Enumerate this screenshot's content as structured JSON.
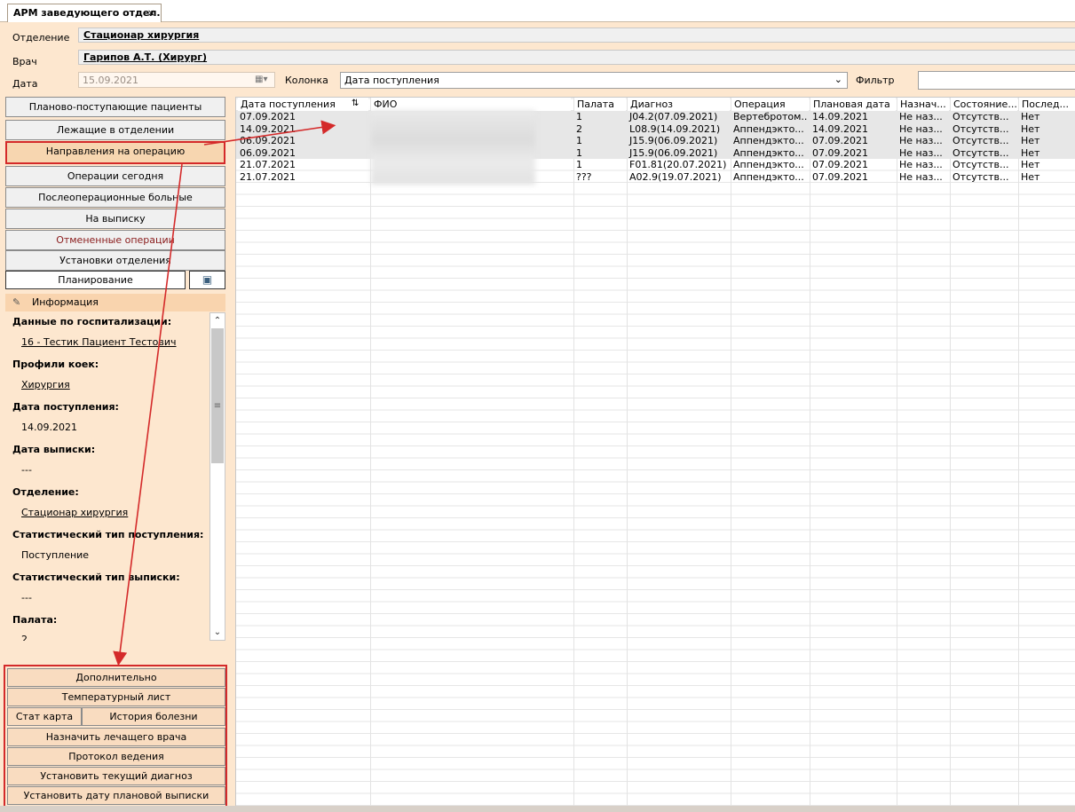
{
  "tab": {
    "title": "АРМ заведующего отдел...",
    "close": "×"
  },
  "header": {
    "department_label": "Отделение",
    "department_value": "Стационар  хирургия",
    "doctor_label": "Врач",
    "doctor_value": "Гарипов А.Т. (Хирург)",
    "date_label": "Дата",
    "date_value": "15.09.2021",
    "column_label": "Колонка",
    "column_value": "Дата поступления",
    "filter_label": "Фильтр",
    "filter_value": ""
  },
  "nav": [
    {
      "label": "Планово-поступающие пациенты"
    },
    {
      "label": "Лежащие в отделении"
    },
    {
      "label": "Направления на операцию"
    },
    {
      "label": "Операции сегодня"
    },
    {
      "label": "Послеоперационные больные"
    },
    {
      "label": "На выписку"
    },
    {
      "label": "Отмененные операции"
    },
    {
      "label": "Установки отделения"
    }
  ],
  "planning_label": "Планирование",
  "info": {
    "title": "Информация",
    "hosp_title": "Данные по госпитализации:",
    "hosp_value": "16 - Тестик Пациент Тестович",
    "beds_title": "Профили коек:",
    "beds_value": "Хирургия",
    "admit_title": "Дата поступления:",
    "admit_value": "14.09.2021",
    "discharge_title": "Дата выписки:",
    "discharge_value": "---",
    "dept_title": "Отделение:",
    "dept_value": "Стационар  хирургия",
    "stat_in_title": "Статистический тип поступления:",
    "stat_in_value": "Поступление",
    "stat_out_title": "Статистический тип выписки:",
    "stat_out_value": "---",
    "ward_title": "Палата:",
    "ward_value": "2"
  },
  "actions": {
    "extra": "Дополнительно",
    "temp_sheet": "Температурный лист",
    "stat_card": "Стат карта",
    "history": "История болезни",
    "assign_doctor": "Назначить лечащего врача",
    "protocol": "Протокол ведения",
    "set_diagnosis": "Установить текущий диагноз",
    "set_discharge": "Установить дату плановой выписки"
  },
  "grid": {
    "headers": [
      "Дата поступления",
      "ФИО",
      "Палата",
      "Диагноз",
      "Операция",
      "Плановая дата",
      "Назнач...",
      "Состояние...",
      "Послед..."
    ],
    "rows": [
      [
        "07.09.2021",
        "",
        "1",
        "J04.2(07.09.2021)",
        "Вертебротом...",
        "14.09.2021",
        "Не наз...",
        "Отсутств...",
        "Нет"
      ],
      [
        "14.09.2021",
        "",
        "2",
        "L08.9(14.09.2021)",
        "Аппендэкто...",
        "14.09.2021",
        "Не наз...",
        "Отсутств...",
        "Нет"
      ],
      [
        "06.09.2021",
        "",
        "1",
        "J15.9(06.09.2021)",
        "Аппендэкто...",
        "07.09.2021",
        "Не наз...",
        "Отсутств...",
        "Нет"
      ],
      [
        "06.09.2021",
        "",
        "1",
        "J15.9(06.09.2021)",
        "Аппендэкто...",
        "07.09.2021",
        "Не наз...",
        "Отсутств...",
        "Нет"
      ],
      [
        "21.07.2021",
        "",
        "1",
        "F01.81(20.07.2021)",
        "Аппендэкто...",
        "07.09.2021",
        "Не наз...",
        "Отсутств...",
        "Нет"
      ],
      [
        "21.07.2021",
        "",
        "???",
        "A02.9(19.07.2021)",
        "Аппендэкто...",
        "07.09.2021",
        "Не наз...",
        "Отсутств...",
        "Нет"
      ]
    ]
  },
  "colors": {
    "background": "#fde7cf",
    "highlight_border": "#d42a2a",
    "active_button": "#f7d6b0"
  }
}
